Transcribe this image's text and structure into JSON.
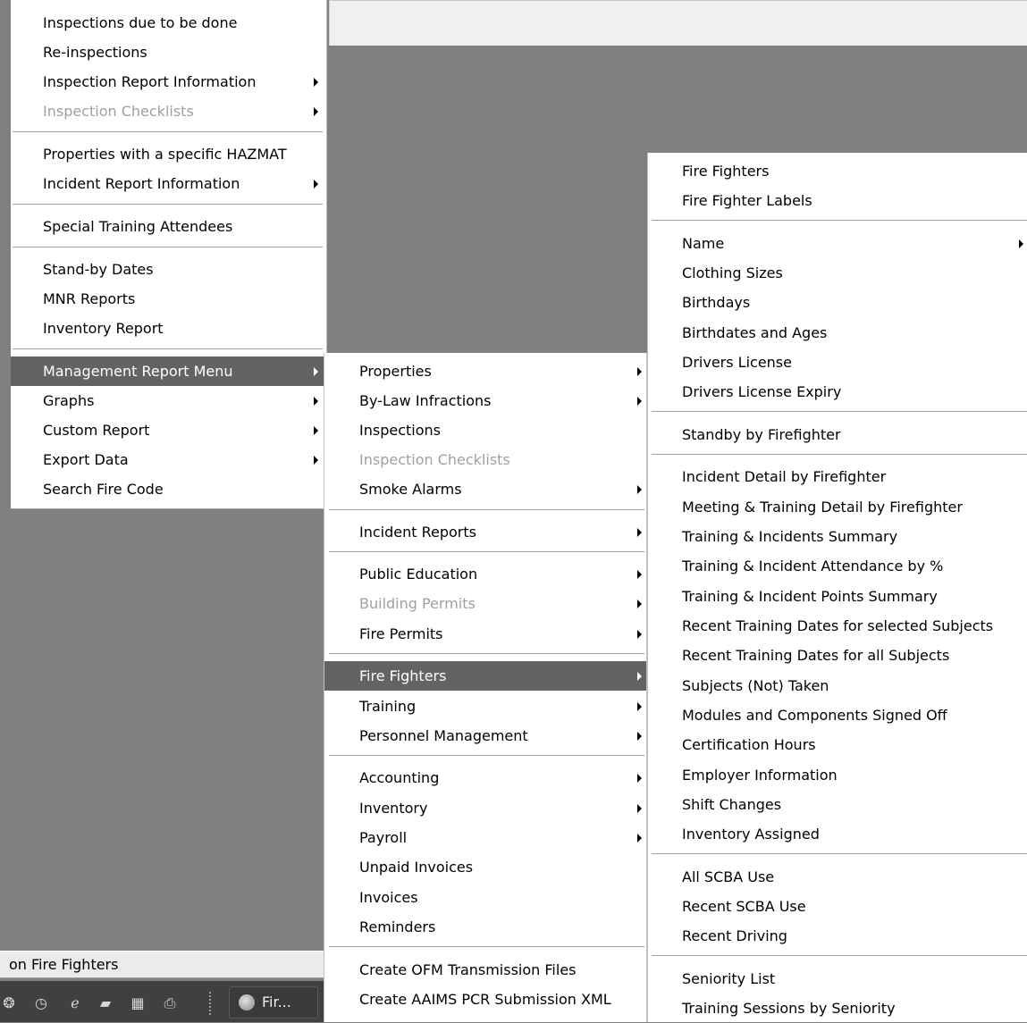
{
  "status_bar": {
    "text": "on Fire Fighters"
  },
  "taskbar": {
    "quick_launch": [
      "firefox-icon",
      "clock-icon",
      "ie-icon",
      "document-icon",
      "pkg-icon",
      "printer-icon"
    ],
    "task_label": "Fir..."
  },
  "main_menu": {
    "items": [
      {
        "label": "Inspections due to be done"
      },
      {
        "label": "Re-inspections"
      },
      {
        "label": "Inspection Report Information"
      },
      {
        "label": "Inspection Checklists"
      },
      {
        "label": "Properties with a specific HAZMAT"
      },
      {
        "label": "Incident Report Information"
      },
      {
        "label": "Special Training Attendees"
      },
      {
        "label": "Stand-by Dates"
      },
      {
        "label": "MNR Reports"
      },
      {
        "label": "Inventory Report"
      },
      {
        "label": "Management Report Menu"
      },
      {
        "label": "Graphs"
      },
      {
        "label": "Custom Report"
      },
      {
        "label": "Export Data"
      },
      {
        "label": "Search Fire Code"
      }
    ]
  },
  "management_menu": {
    "items": [
      {
        "label": "Properties"
      },
      {
        "label": "By-Law Infractions"
      },
      {
        "label": "Inspections"
      },
      {
        "label": "Inspection Checklists"
      },
      {
        "label": "Smoke Alarms"
      },
      {
        "label": "Incident Reports"
      },
      {
        "label": "Public Education"
      },
      {
        "label": "Building Permits"
      },
      {
        "label": "Fire Permits"
      },
      {
        "label": "Fire Fighters"
      },
      {
        "label": "Training"
      },
      {
        "label": "Personnel Management"
      },
      {
        "label": "Accounting"
      },
      {
        "label": "Inventory"
      },
      {
        "label": "Payroll"
      },
      {
        "label": "Unpaid Invoices"
      },
      {
        "label": "Invoices"
      },
      {
        "label": "Reminders"
      },
      {
        "label": "Create OFM Transmission Files"
      },
      {
        "label": "Create AAIMS PCR Submission XML"
      }
    ]
  },
  "fire_fighters_menu": {
    "items": [
      {
        "label": "Fire Fighters"
      },
      {
        "label": "Fire Fighter Labels"
      },
      {
        "label": "Name"
      },
      {
        "label": "Clothing Sizes"
      },
      {
        "label": "Birthdays"
      },
      {
        "label": "Birthdates and Ages"
      },
      {
        "label": "Drivers License"
      },
      {
        "label": "Drivers License Expiry"
      },
      {
        "label": "Standby by Firefighter"
      },
      {
        "label": "Incident Detail by Firefighter"
      },
      {
        "label": "Meeting & Training Detail by Firefighter"
      },
      {
        "label": "Training & Incidents Summary"
      },
      {
        "label": "Training & Incident Attendance by %"
      },
      {
        "label": "Training & Incident Points Summary"
      },
      {
        "label": "Recent Training Dates for selected Subjects"
      },
      {
        "label": "Recent Training Dates for all Subjects"
      },
      {
        "label": "Subjects (Not) Taken"
      },
      {
        "label": "Modules and Components Signed Off"
      },
      {
        "label": "Certification Hours"
      },
      {
        "label": "Employer Information"
      },
      {
        "label": "Shift Changes"
      },
      {
        "label": "Inventory Assigned"
      },
      {
        "label": "All SCBA Use"
      },
      {
        "label": "Recent SCBA Use"
      },
      {
        "label": "Recent Driving"
      },
      {
        "label": "Seniority List"
      },
      {
        "label": "Training Sessions by Seniority"
      }
    ]
  }
}
